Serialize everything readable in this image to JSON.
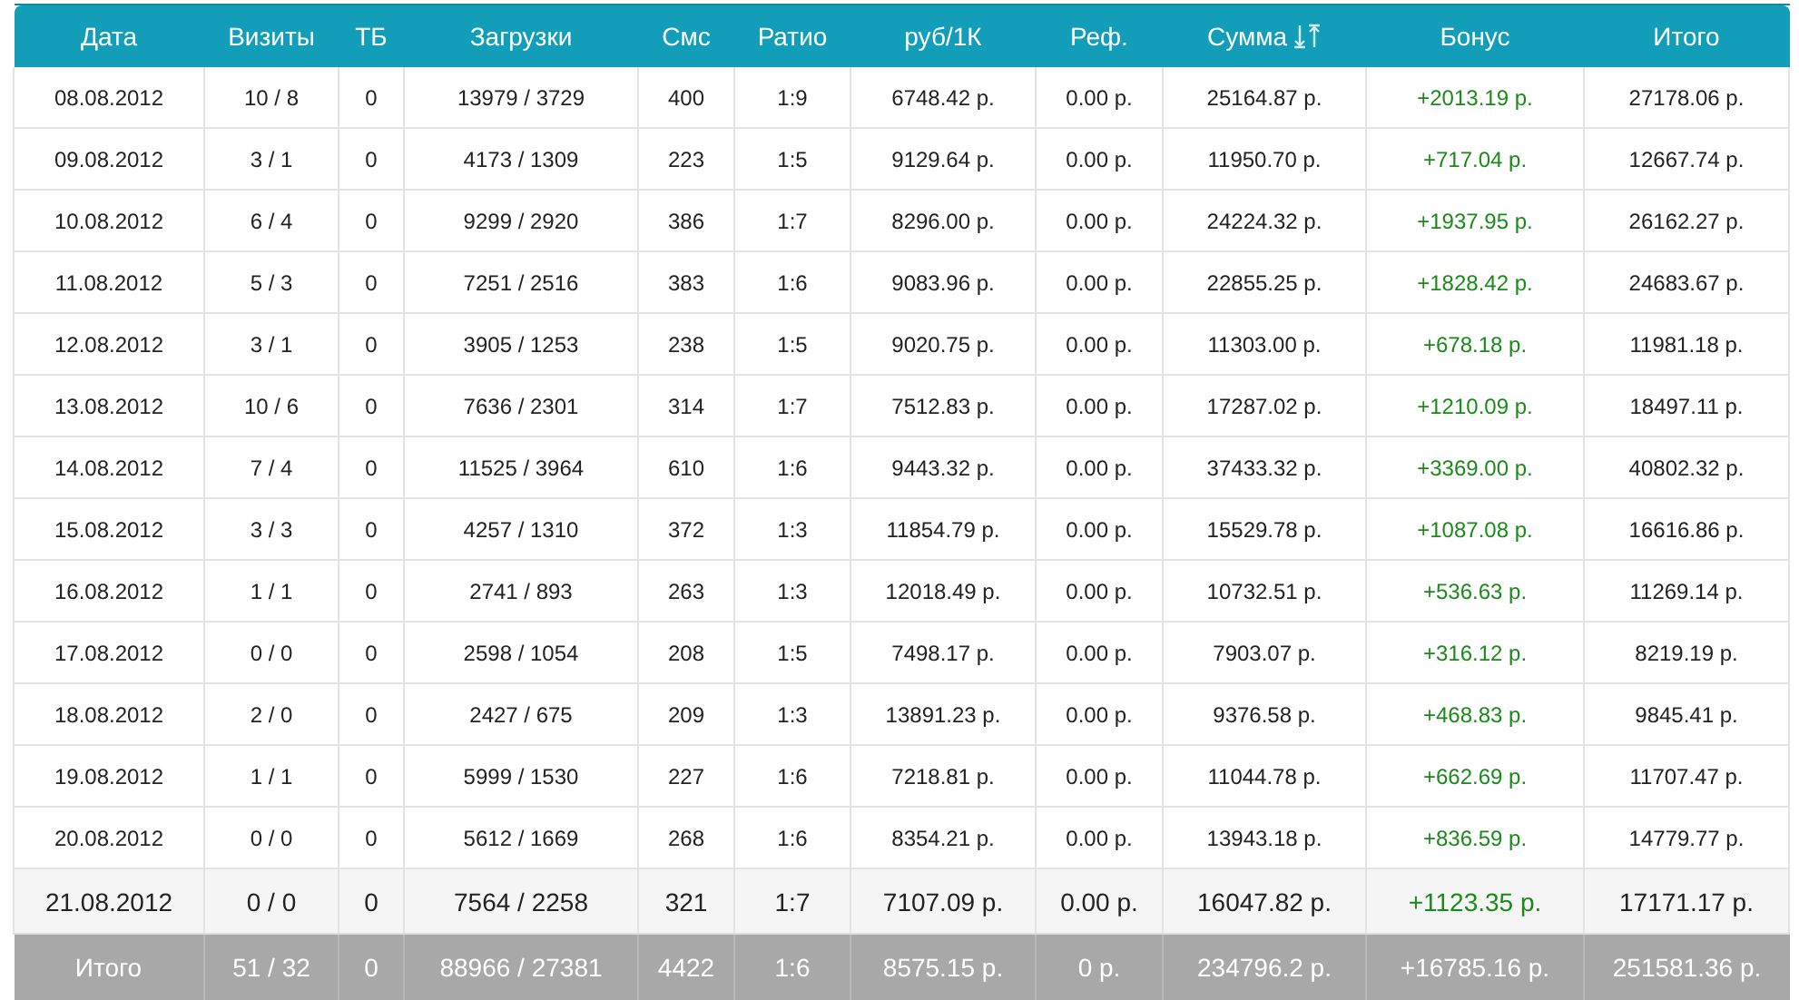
{
  "table": {
    "columns": [
      {
        "label": "Дата",
        "sortable": false
      },
      {
        "label": "Визиты",
        "sortable": false
      },
      {
        "label": "ТБ",
        "sortable": false
      },
      {
        "label": "Загрузки",
        "sortable": false
      },
      {
        "label": "Смс",
        "sortable": false
      },
      {
        "label": "Ратио",
        "sortable": false
      },
      {
        "label": "руб/1К",
        "sortable": false
      },
      {
        "label": "Реф.",
        "sortable": false
      },
      {
        "label": "Сумма",
        "sortable": true
      },
      {
        "label": "Бонус",
        "sortable": false
      },
      {
        "label": "Итого",
        "sortable": false
      }
    ],
    "rows": [
      {
        "kind": "day",
        "cells": [
          "08.08.2012",
          "10 / 8",
          "0",
          "13979 / 3729",
          "400",
          "1:9",
          "6748.42 р.",
          "0.00 р.",
          "25164.87 р.",
          "+2013.19 р.",
          "27178.06 р."
        ]
      },
      {
        "kind": "day",
        "cells": [
          "09.08.2012",
          "3 / 1",
          "0",
          "4173 / 1309",
          "223",
          "1:5",
          "9129.64 р.",
          "0.00 р.",
          "11950.70 р.",
          "+717.04 р.",
          "12667.74 р."
        ]
      },
      {
        "kind": "day",
        "cells": [
          "10.08.2012",
          "6 / 4",
          "0",
          "9299 / 2920",
          "386",
          "1:7",
          "8296.00 р.",
          "0.00 р.",
          "24224.32 р.",
          "+1937.95 р.",
          "26162.27 р."
        ]
      },
      {
        "kind": "day",
        "cells": [
          "11.08.2012",
          "5 / 3",
          "0",
          "7251 / 2516",
          "383",
          "1:6",
          "9083.96 р.",
          "0.00 р.",
          "22855.25 р.",
          "+1828.42 р.",
          "24683.67 р."
        ]
      },
      {
        "kind": "day",
        "cells": [
          "12.08.2012",
          "3 / 1",
          "0",
          "3905 / 1253",
          "238",
          "1:5",
          "9020.75 р.",
          "0.00 р.",
          "11303.00 р.",
          "+678.18 р.",
          "11981.18 р."
        ]
      },
      {
        "kind": "day",
        "cells": [
          "13.08.2012",
          "10 / 6",
          "0",
          "7636 / 2301",
          "314",
          "1:7",
          "7512.83 р.",
          "0.00 р.",
          "17287.02 р.",
          "+1210.09 р.",
          "18497.11 р."
        ]
      },
      {
        "kind": "day",
        "cells": [
          "14.08.2012",
          "7 / 4",
          "0",
          "11525 / 3964",
          "610",
          "1:6",
          "9443.32 р.",
          "0.00 р.",
          "37433.32 р.",
          "+3369.00 р.",
          "40802.32 р."
        ]
      },
      {
        "kind": "day",
        "cells": [
          "15.08.2012",
          "3 / 3",
          "0",
          "4257 / 1310",
          "372",
          "1:3",
          "11854.79 р.",
          "0.00 р.",
          "15529.78 р.",
          "+1087.08 р.",
          "16616.86 р."
        ]
      },
      {
        "kind": "day",
        "cells": [
          "16.08.2012",
          "1 / 1",
          "0",
          "2741 / 893",
          "263",
          "1:3",
          "12018.49 р.",
          "0.00 р.",
          "10732.51 р.",
          "+536.63 р.",
          "11269.14 р."
        ]
      },
      {
        "kind": "day",
        "cells": [
          "17.08.2012",
          "0 / 0",
          "0",
          "2598 / 1054",
          "208",
          "1:5",
          "7498.17 р.",
          "0.00 р.",
          "7903.07 р.",
          "+316.12 р.",
          "8219.19 р."
        ]
      },
      {
        "kind": "day",
        "cells": [
          "18.08.2012",
          "2 / 0",
          "0",
          "2427 / 675",
          "209",
          "1:3",
          "13891.23 р.",
          "0.00 р.",
          "9376.58 р.",
          "+468.83 р.",
          "9845.41 р."
        ]
      },
      {
        "kind": "day",
        "cells": [
          "19.08.2012",
          "1 / 1",
          "0",
          "5999 / 1530",
          "227",
          "1:6",
          "7218.81 р.",
          "0.00 р.",
          "11044.78 р.",
          "+662.69 р.",
          "11707.47 р."
        ]
      },
      {
        "kind": "day",
        "cells": [
          "20.08.2012",
          "0 / 0",
          "0",
          "5612 / 1669",
          "268",
          "1:6",
          "8354.21 р.",
          "0.00 р.",
          "13943.18 р.",
          "+836.59 р.",
          "14779.77 р."
        ]
      },
      {
        "kind": "current",
        "cells": [
          "21.08.2012",
          "0 / 0",
          "0",
          "7564 / 2258",
          "321",
          "1:7",
          "7107.09 р.",
          "0.00 р.",
          "16047.82 р.",
          "+1123.35 р.",
          "17171.17 р."
        ]
      }
    ],
    "totals": [
      "Итого",
      "51 / 32",
      "0",
      "88966 / 27381",
      "4422",
      "1:6",
      "8575.15 р.",
      "0 р.",
      "234796.2 р.",
      "+16785.16 р.",
      "251581.36 р."
    ]
  }
}
